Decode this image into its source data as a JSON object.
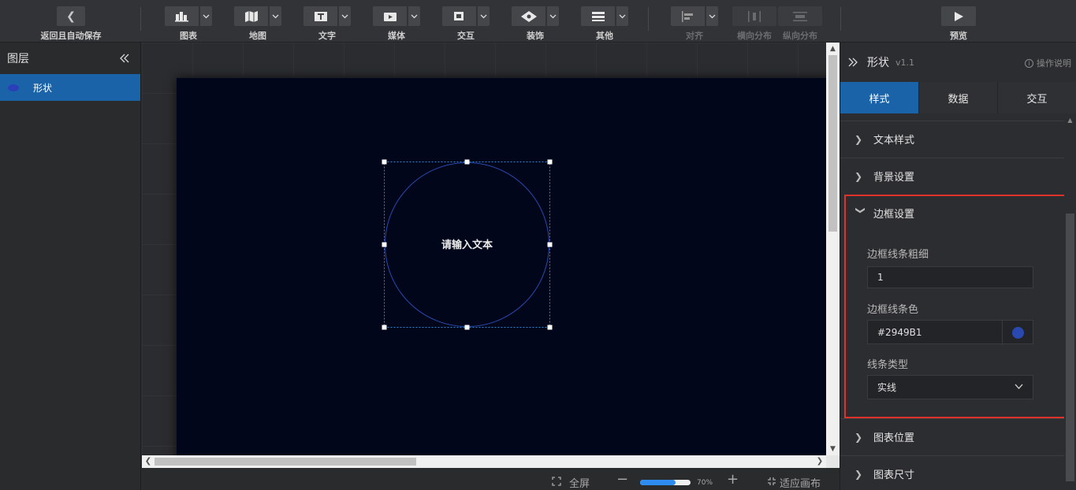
{
  "toolbar": {
    "back_label": "返回且自动保存",
    "tools": [
      {
        "label": "图表",
        "icon": "chart-icon"
      },
      {
        "label": "地图",
        "icon": "map-icon"
      },
      {
        "label": "文字",
        "icon": "text-icon"
      },
      {
        "label": "媒体",
        "icon": "media-icon"
      },
      {
        "label": "交互",
        "icon": "interaction-icon"
      },
      {
        "label": "装饰",
        "icon": "decoration-icon"
      },
      {
        "label": "其他",
        "icon": "other-icon"
      }
    ],
    "align_label": "对齐",
    "h_distribute_label": "横向分布",
    "v_distribute_label": "纵向分布",
    "preview_label": "预览"
  },
  "layers": {
    "title": "图层",
    "items": [
      {
        "label": "形状",
        "selected": true
      }
    ]
  },
  "canvas": {
    "shape_text": "请输入文本",
    "border_color": "#2949B1"
  },
  "status": {
    "fullscreen_label": "全屏",
    "zoom_percent": 70,
    "zoom_label": "70%",
    "fit_label": "适应画布"
  },
  "props": {
    "title": "形状",
    "version": "v1.1",
    "help_label": "操作说明",
    "tabs": [
      {
        "label": "样式",
        "active": true
      },
      {
        "label": "数据",
        "active": false
      },
      {
        "label": "交互",
        "active": false
      }
    ],
    "sections": {
      "text_style": "文本样式",
      "background": "背景设置",
      "border": "边框设置",
      "position": "图表位置",
      "size": "图表尺寸"
    },
    "border": {
      "width_label": "边框线条粗细",
      "width_value": "1",
      "color_label": "边框线条色",
      "color_value": "#2949B1",
      "type_label": "线条类型",
      "type_value": "实线"
    }
  }
}
